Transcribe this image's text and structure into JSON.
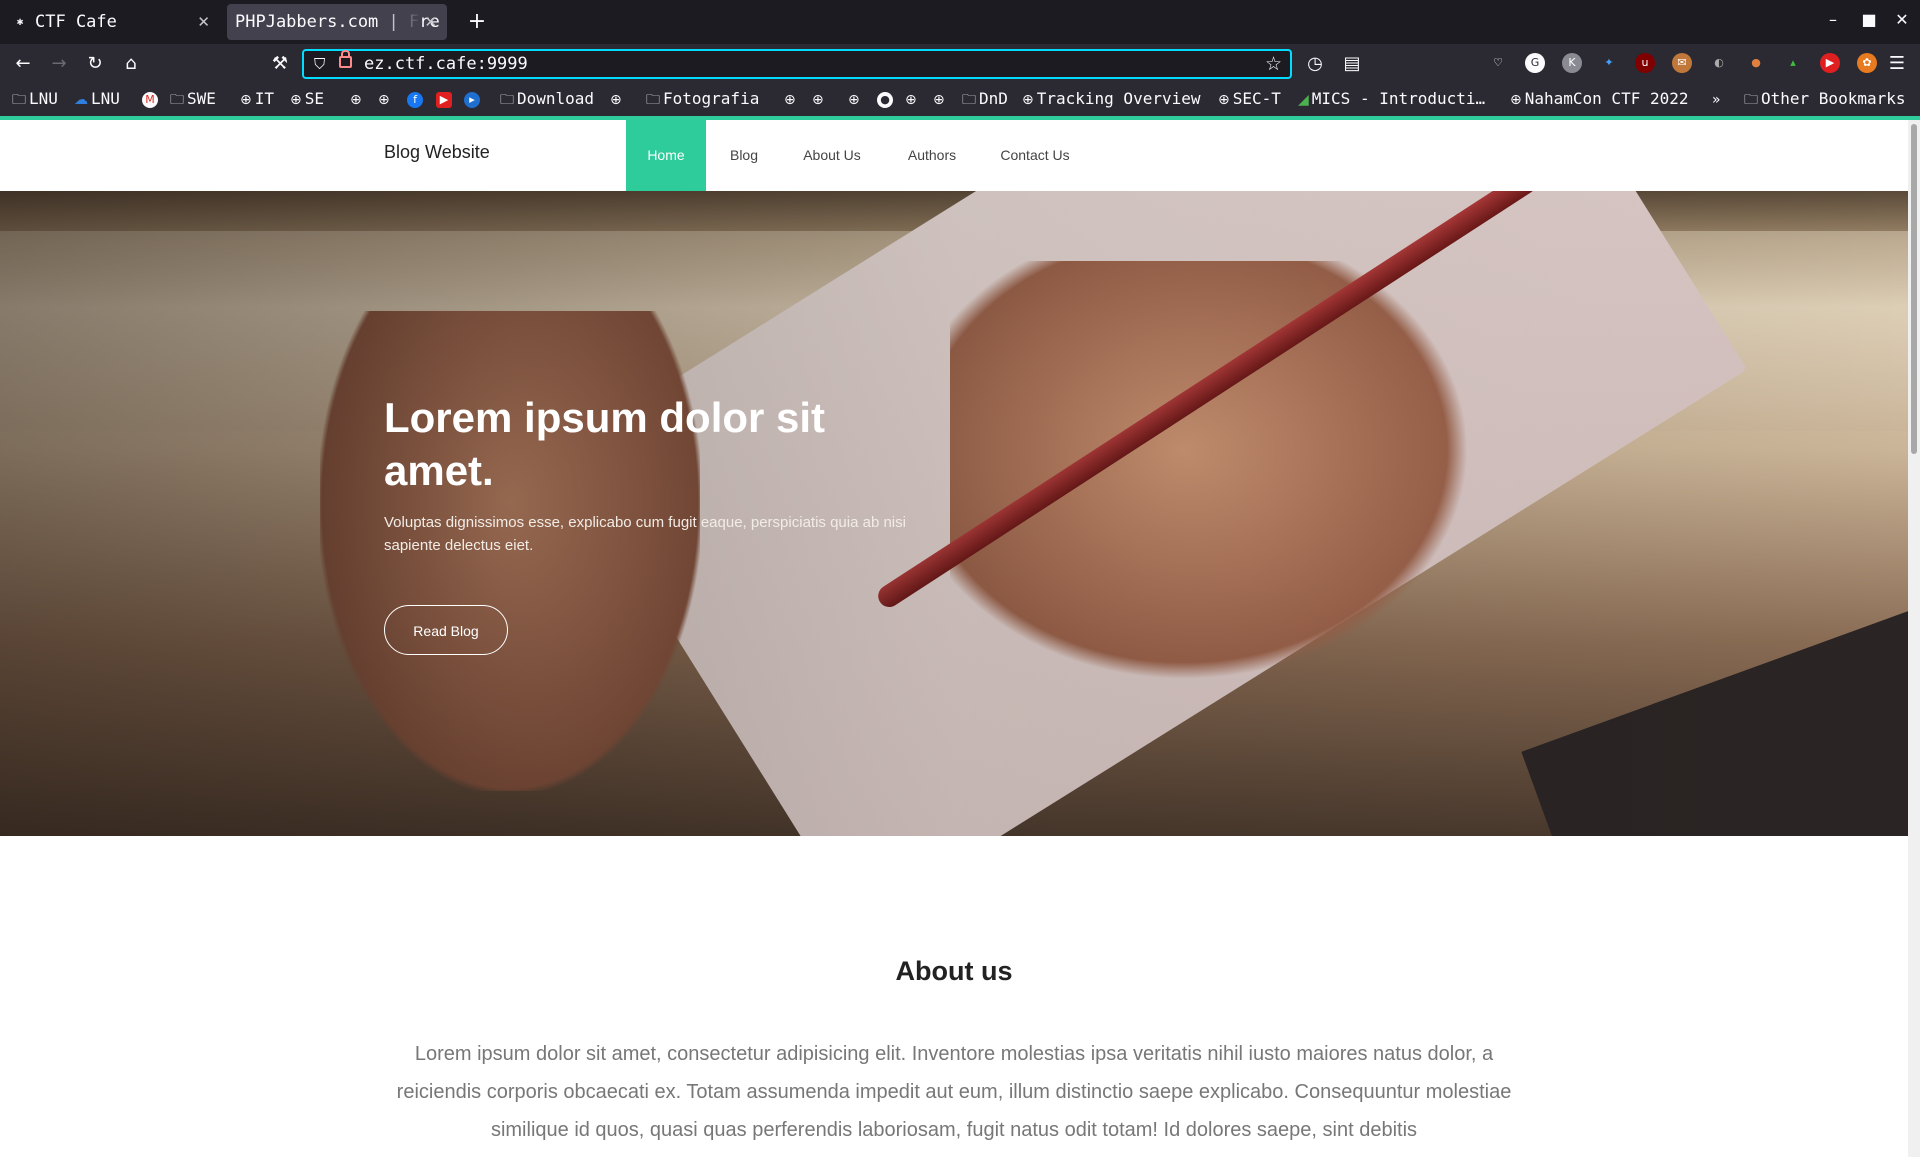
{
  "browser": {
    "tabs": [
      {
        "label": "CTF Cafe"
      },
      {
        "label": "PHPJabbers.com | Fre"
      }
    ],
    "url": "ez.ctf.cafe:9999",
    "bookmarks": [
      "LNU",
      "LNU",
      "SWE",
      "IT",
      "SE",
      "Download",
      "Fotografia",
      "DnD",
      "Tracking Overview",
      "SEC-T",
      "MICS - Introducti…",
      "NahamCon CTF 2022",
      "Other Bookmarks"
    ]
  },
  "site": {
    "brand": "Blog Website",
    "menu": [
      "Home",
      "Blog",
      "About Us",
      "Authors",
      "Contact Us"
    ],
    "hero": {
      "title": "Lorem ipsum dolor sit amet.",
      "subtitle": "Voluptas dignissimos esse, explicabo cum fugit eaque, perspiciatis quia ab nisi sapiente delectus eiet.",
      "button": "Read Blog"
    },
    "about": {
      "title": "About us",
      "text": "Lorem ipsum dolor sit amet, consectetur adipisicing elit. Inventore molestias ipsa veritatis nihil iusto maiores natus dolor, a reiciendis corporis obcaecati ex. Totam assumenda impedit aut eum, illum distinctio saepe explicabo. Consequuntur molestiae similique id quos, quasi quas perferendis laboriosam, fugit natus odit totam! Id dolores saepe, sint debitis"
    }
  },
  "colors": {
    "accent": "#2ecc9a",
    "url_focus": "#00ddff",
    "chrome_dark": "#1c1b22",
    "chrome": "#2b2a33"
  }
}
